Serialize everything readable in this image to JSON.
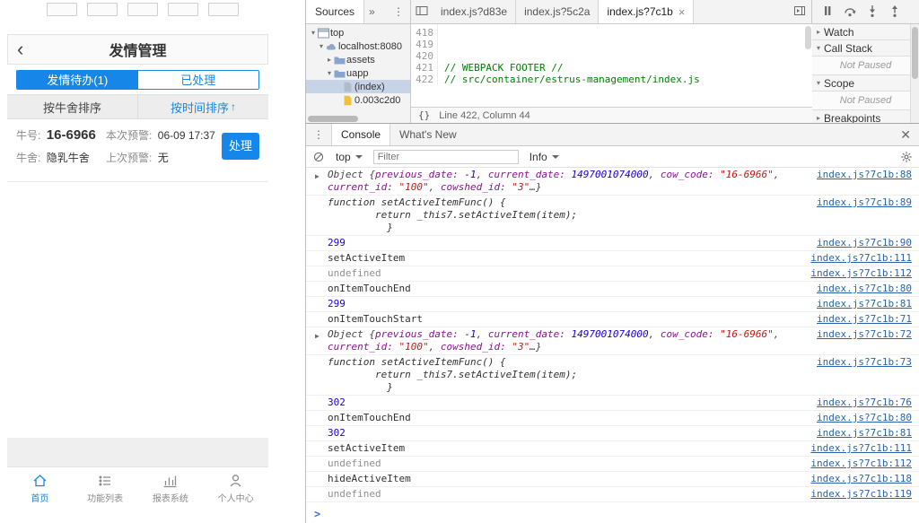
{
  "app": {
    "header": {
      "title": "发情管理"
    },
    "tabs": [
      {
        "label": "发情待办(1)",
        "active": true
      },
      {
        "label": "已处理",
        "active": false
      }
    ],
    "sort": {
      "left": "按牛舍排序",
      "right": "按时间排序",
      "arrow": "↑"
    },
    "card": {
      "cow_label": "牛号:",
      "cow_value": "16-6966",
      "current_label": "本次预警:",
      "current_value": "06-09 17:37",
      "shed_label": "牛舍:",
      "shed_value": "隐乳牛舍",
      "prev_label": "上次预警:",
      "prev_value": "无",
      "action": "处理"
    },
    "nav": [
      {
        "label": "首页",
        "icon": "home-icon",
        "active": true
      },
      {
        "label": "功能列表",
        "icon": "list-icon",
        "active": false
      },
      {
        "label": "报表系统",
        "icon": "chart-icon",
        "active": false
      },
      {
        "label": "个人中心",
        "icon": "user-icon",
        "active": false
      }
    ]
  },
  "devtools": {
    "panel_tab": "Sources",
    "more_tabs_glyph": "»",
    "file_tabs": [
      {
        "label": "index.js?d83e",
        "active": false,
        "closable": false
      },
      {
        "label": "index.js?5c2a",
        "active": false,
        "closable": false
      },
      {
        "label": "index.js?7c1b",
        "active": true,
        "closable": true
      }
    ],
    "navigator": [
      {
        "depth": 0,
        "arrow": "▾",
        "icon": "frame-icon",
        "label": "top",
        "selected": false
      },
      {
        "depth": 1,
        "arrow": "▾",
        "icon": "domain-icon",
        "label": "localhost:8080",
        "selected": false
      },
      {
        "depth": 2,
        "arrow": "▸",
        "icon": "folder-icon",
        "label": "assets",
        "selected": false
      },
      {
        "depth": 2,
        "arrow": "▾",
        "icon": "folder-icon",
        "label": "uapp",
        "selected": false
      },
      {
        "depth": 3,
        "arrow": "",
        "icon": "file-icon",
        "label": "(index)",
        "selected": true
      },
      {
        "depth": 3,
        "arrow": "",
        "icon": "script-icon",
        "label": "0.003c2d0",
        "selected": false
      }
    ],
    "editor": {
      "lines": [
        {
          "num": "418",
          "text": ""
        },
        {
          "num": "419",
          "text": ""
        },
        {
          "num": "420",
          "text": ""
        },
        {
          "num": "421",
          "text": "// WEBPACK FOOTER //"
        },
        {
          "num": "422",
          "text": "// src/container/estrus-management/index.js"
        }
      ],
      "pretty_print": "{}",
      "status": "Line 422, Column 44"
    },
    "debug_sidebar": [
      {
        "title": "Watch",
        "arrow": "▸",
        "content": ""
      },
      {
        "title": "Call Stack",
        "arrow": "▾",
        "content": "Not Paused"
      },
      {
        "title": "Scope",
        "arrow": "▾",
        "content": "Not Paused"
      },
      {
        "title": "Breakpoints",
        "arrow": "▸",
        "content": ""
      }
    ],
    "console": {
      "tabs": [
        "Console",
        "What's New"
      ],
      "toolbar": {
        "context": "top",
        "filter_placeholder": "Filter",
        "level": "Info"
      },
      "prompt": ">",
      "messages": [
        {
          "kind": "preview",
          "link": "index.js?7c1b:88",
          "segments": [
            [
              "lbl",
              "Object {"
            ],
            [
              "key",
              "previous_date: "
            ],
            [
              "num",
              "-1"
            ],
            [
              "pln",
              ", "
            ],
            [
              "key",
              "current_date: "
            ],
            [
              "num",
              "1497001074000"
            ],
            [
              "pln",
              ", "
            ],
            [
              "key",
              "cow_code: "
            ],
            [
              "str",
              "\"16-6966\""
            ],
            [
              "pln",
              ", "
            ],
            [
              "key",
              "current_id: "
            ],
            [
              "str",
              "\"100\""
            ],
            [
              "pln",
              ", "
            ],
            [
              "key",
              "cowshed_id: "
            ],
            [
              "str",
              "\"3\""
            ],
            [
              "lbl",
              "…}"
            ]
          ]
        },
        {
          "kind": "function",
          "link": "index.js?7c1b:89",
          "lines": [
            "function setActiveItemFunc() {",
            "        return _this7.setActiveItem(item);",
            "          }"
          ]
        },
        {
          "kind": "num",
          "text": "299",
          "link": "index.js?7c1b:90"
        },
        {
          "kind": "text",
          "text": "setActiveItem",
          "link": "index.js?7c1b:111"
        },
        {
          "kind": "undef",
          "text": "undefined",
          "link": "index.js?7c1b:112"
        },
        {
          "kind": "text",
          "text": "onItemTouchEnd",
          "link": "index.js?7c1b:80"
        },
        {
          "kind": "num",
          "text": "299",
          "link": "index.js?7c1b:81"
        },
        {
          "kind": "text",
          "text": "onItemTouchStart",
          "link": "index.js?7c1b:71"
        },
        {
          "kind": "preview",
          "link": "index.js?7c1b:72",
          "segments": [
            [
              "lbl",
              "Object {"
            ],
            [
              "key",
              "previous_date: "
            ],
            [
              "num",
              "-1"
            ],
            [
              "pln",
              ", "
            ],
            [
              "key",
              "current_date: "
            ],
            [
              "num",
              "1497001074000"
            ],
            [
              "pln",
              ", "
            ],
            [
              "key",
              "cow_code: "
            ],
            [
              "str",
              "\"16-6966\""
            ],
            [
              "pln",
              ", "
            ],
            [
              "key",
              "current_id: "
            ],
            [
              "str",
              "\"100\""
            ],
            [
              "pln",
              ", "
            ],
            [
              "key",
              "cowshed_id: "
            ],
            [
              "str",
              "\"3\""
            ],
            [
              "lbl",
              "…}"
            ]
          ]
        },
        {
          "kind": "function",
          "link": "index.js?7c1b:73",
          "lines": [
            "function setActiveItemFunc() {",
            "        return _this7.setActiveItem(item);",
            "          }"
          ]
        },
        {
          "kind": "num",
          "text": "302",
          "link": "index.js?7c1b:76"
        },
        {
          "kind": "text",
          "text": "onItemTouchEnd",
          "link": "index.js?7c1b:80"
        },
        {
          "kind": "num",
          "text": "302",
          "link": "index.js?7c1b:81"
        },
        {
          "kind": "text",
          "text": "setActiveItem",
          "link": "index.js?7c1b:111"
        },
        {
          "kind": "undef",
          "text": "undefined",
          "link": "index.js?7c1b:112"
        },
        {
          "kind": "text",
          "text": "hideActiveItem",
          "link": "index.js?7c1b:118"
        },
        {
          "kind": "undef",
          "text": "undefined",
          "link": "index.js?7c1b:119"
        }
      ]
    }
  },
  "colors": {
    "accent_blue": "#1687e8",
    "console_link_blue": "#2b63a8",
    "comment_green": "#008000",
    "number_blue": "#1c00cf",
    "string_red": "#c41a16",
    "key_purple": "#881391"
  }
}
